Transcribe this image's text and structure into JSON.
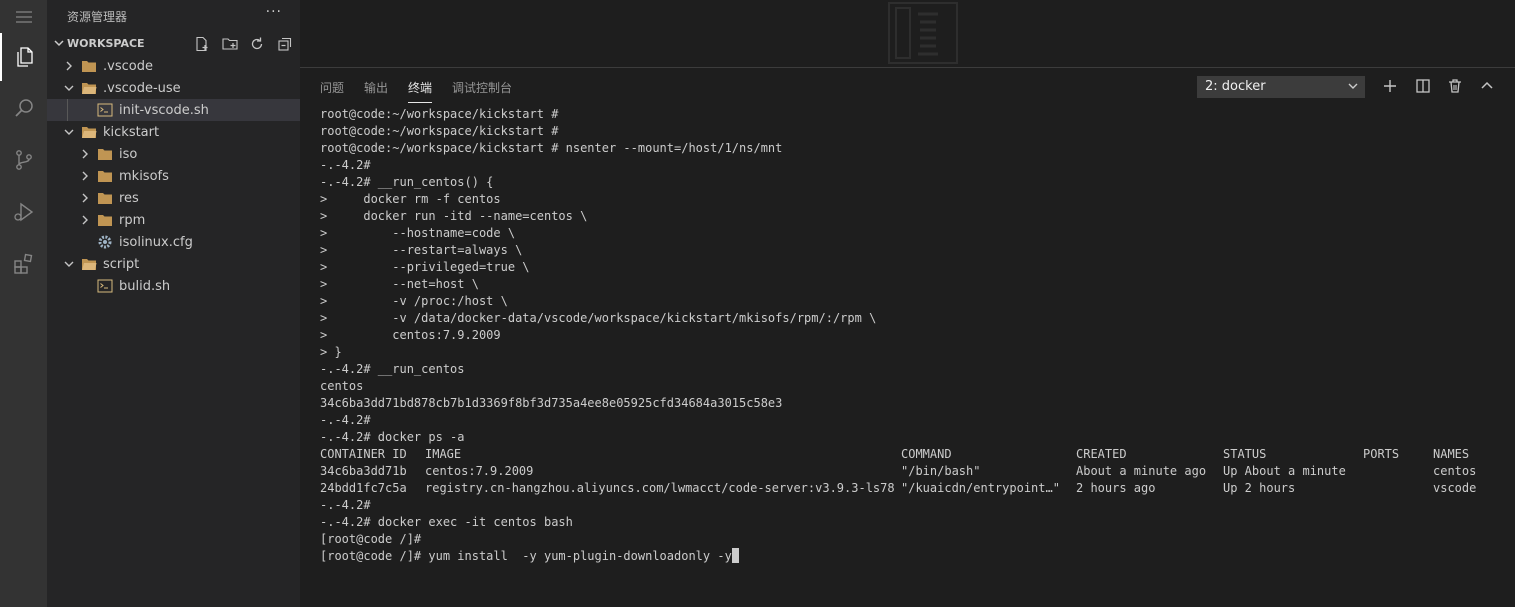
{
  "sidebar": {
    "title": "资源管理器",
    "more": "···",
    "workspace": "WORKSPACE",
    "tree": [
      {
        "label": ".vscode",
        "type": "folder",
        "depth": 0,
        "expanded": false
      },
      {
        "label": ".vscode-use",
        "type": "folder",
        "depth": 0,
        "expanded": true
      },
      {
        "label": "init-vscode.sh",
        "type": "file",
        "depth": 1,
        "selected": true
      },
      {
        "label": "kickstart",
        "type": "folder",
        "depth": 0,
        "expanded": true
      },
      {
        "label": "iso",
        "type": "folder",
        "depth": 1,
        "expanded": false
      },
      {
        "label": "mkisofs",
        "type": "folder",
        "depth": 1,
        "expanded": false
      },
      {
        "label": "res",
        "type": "folder",
        "depth": 1,
        "expanded": false
      },
      {
        "label": "rpm",
        "type": "folder",
        "depth": 1,
        "expanded": false
      },
      {
        "label": "isolinux.cfg",
        "type": "file",
        "depth": 1
      },
      {
        "label": "script",
        "type": "folder",
        "depth": 0,
        "expanded": true
      },
      {
        "label": "bulid.sh",
        "type": "file",
        "depth": 1
      }
    ]
  },
  "panel": {
    "tabs": [
      {
        "label": "问题",
        "active": false
      },
      {
        "label": "输出",
        "active": false
      },
      {
        "label": "终端",
        "active": true
      },
      {
        "label": "调试控制台",
        "active": false
      }
    ],
    "terminal_select": "2: docker"
  },
  "terminal": {
    "lines": [
      "root@code:~/workspace/kickstart #",
      "root@code:~/workspace/kickstart #",
      "root@code:~/workspace/kickstart # nsenter --mount=/host/1/ns/mnt",
      "-.-4.2#",
      "-.-4.2# __run_centos() {",
      ">     docker rm -f centos",
      ">     docker run -itd --name=centos \\",
      ">         --hostname=code \\",
      ">         --restart=always \\",
      ">         --privileged=true \\",
      ">         --net=host \\",
      ">         -v /proc:/host \\",
      ">         -v /data/docker-data/vscode/workspace/kickstart/mkisofs/rpm/:/rpm \\",
      ">         centos:7.9.2009",
      "> }",
      "-.-4.2# __run_centos",
      "centos",
      "34c6ba3dd71bd878cb7b1d3369f8bf3d735a4ee8e05925cfd34684a3015c58e3",
      "-.-4.2#",
      "-.-4.2# docker ps -a"
    ],
    "ps_table": {
      "headers": [
        "CONTAINER ID",
        "IMAGE",
        "COMMAND",
        "CREATED",
        "STATUS",
        "PORTS",
        "NAMES"
      ],
      "rows": [
        [
          "34c6ba3dd71b",
          "centos:7.9.2009",
          "\"/bin/bash\"",
          "About a minute ago",
          "Up About a minute",
          "",
          "centos"
        ],
        [
          "24bdd1fc7c5a",
          "registry.cn-hangzhou.aliyuncs.com/lwmacct/code-server:v3.9.3-ls78",
          "\"/kuaicdn/entrypoint…\"",
          "2 hours ago",
          "Up 2 hours",
          "",
          "vscode"
        ]
      ]
    },
    "after_lines": [
      "-.-4.2#",
      "-.-4.2# docker exec -it centos bash",
      "[root@code /]#"
    ],
    "current_line": "[root@code /]# yum install  -y yum-plugin-downloadonly -y"
  }
}
